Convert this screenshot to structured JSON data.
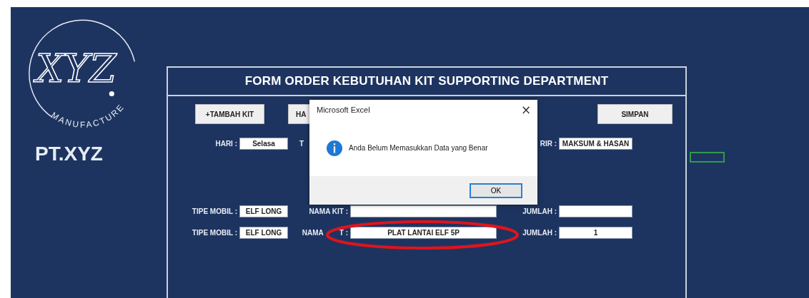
{
  "logo": {
    "mark": "XYZ",
    "tagline": "MANUFACTURE",
    "company": "PT.XYZ"
  },
  "form": {
    "title": "FORM ORDER KEBUTUHAN KIT SUPPORTING DEPARTMENT",
    "buttons": [
      {
        "label": "+TAMBAH KIT"
      },
      {
        "label": "HA"
      }
    ],
    "save_button": "SIMPAN",
    "rows": [
      {
        "label_1": "HARI :",
        "value_1": "Selasa",
        "label_2": "T",
        "label_3": "RIR :",
        "value_3": "MAKSUM & HASAN",
        "kind": "header"
      },
      {
        "label_1": "TIPE MOBIL :",
        "value_1": "ELF LONG",
        "label_2": "NAMA KIT :",
        "value_2": "",
        "label_3": "JUMLAH :",
        "value_3": "",
        "kind": "item"
      },
      {
        "label_1": "TIPE MOBIL :",
        "value_1": "ELF LONG",
        "label_2": "NAMA",
        "label_2_rest": "T :",
        "value_2": "PLAT LANTAI ELF 5P",
        "label_3": "JUMLAH :",
        "value_3": "1",
        "kind": "item",
        "highlighted": true
      }
    ]
  },
  "dialog": {
    "title": "Microsoft Excel",
    "close": "×",
    "message": "Anda Belum Memasukkan Data yang Benar",
    "button": "OK"
  }
}
